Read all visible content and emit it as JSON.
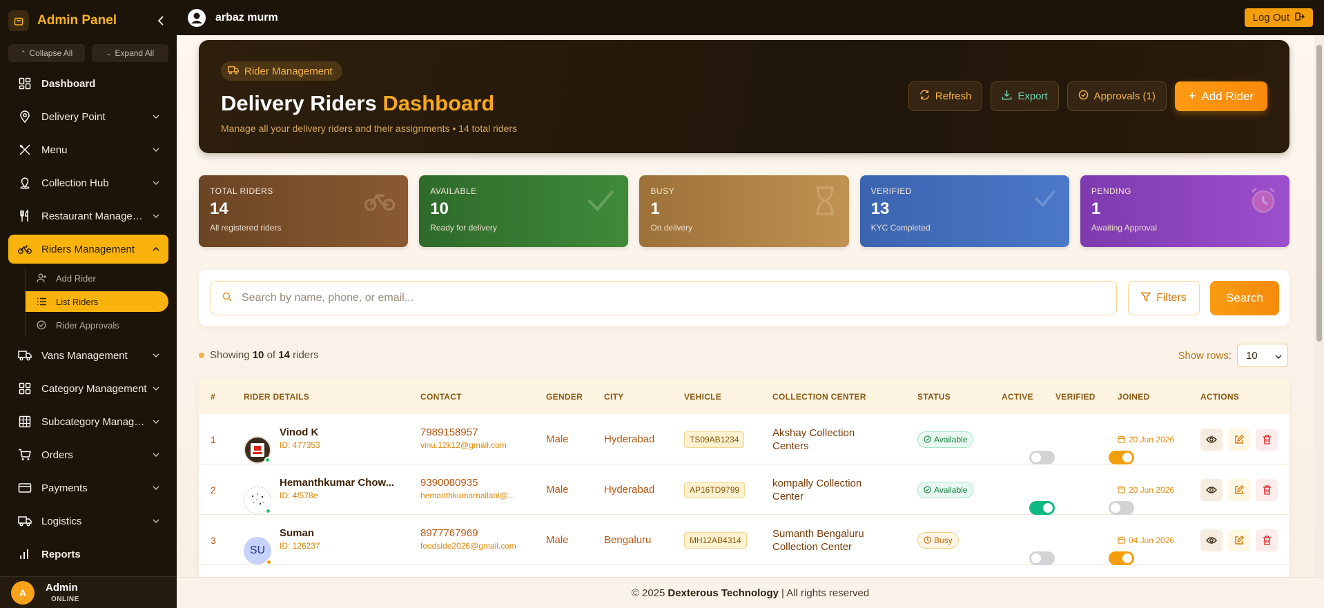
{
  "sidebar": {
    "title": "Admin Panel",
    "collapse_all": "Collapse All",
    "expand_all": "Expand All",
    "items": [
      {
        "label": "Dashboard",
        "icon": "dashboard-icon"
      },
      {
        "label": "Delivery Point",
        "icon": "map-pin-icon"
      },
      {
        "label": "Menu",
        "icon": "utensils-icon"
      },
      {
        "label": "Collection Hub",
        "icon": "location-icon"
      },
      {
        "label": "Restaurant Management",
        "icon": "fork-knife-icon"
      },
      {
        "label": "Riders Management",
        "icon": "bike-icon"
      },
      {
        "label": "Vans Management",
        "icon": "truck-icon"
      },
      {
        "label": "Category Management",
        "icon": "grid-icon"
      },
      {
        "label": "Subcategory Management",
        "icon": "table-icon"
      },
      {
        "label": "Orders",
        "icon": "cart-icon"
      },
      {
        "label": "Payments",
        "icon": "card-icon"
      },
      {
        "label": "Logistics",
        "icon": "truck-icon"
      },
      {
        "label": "Reports",
        "icon": "bar-chart-icon"
      }
    ],
    "sub_items": [
      {
        "label": "Add Rider"
      },
      {
        "label": "List Riders"
      },
      {
        "label": "Rider Approvals"
      }
    ],
    "user": {
      "name": "Admin",
      "status": "ONLINE",
      "initial": "A"
    }
  },
  "topbar": {
    "user_name": "arbaz murm",
    "logout": "Log Out"
  },
  "hero": {
    "badge": "Rider Management",
    "title_main": "Delivery Riders",
    "title_highlight": "Dashboard",
    "subtitle": "Manage all your delivery riders and their assignments • 14 total riders",
    "refresh": "Refresh",
    "export": "Export",
    "approvals": "Approvals (1)",
    "add_rider": "Add Rider"
  },
  "stats": [
    {
      "label": "TOTAL RIDERS",
      "value": "14",
      "desc": "All registered riders"
    },
    {
      "label": "AVAILABLE",
      "value": "10",
      "desc": "Ready for delivery"
    },
    {
      "label": "BUSY",
      "value": "1",
      "desc": "On delivery"
    },
    {
      "label": "VERIFIED",
      "value": "13",
      "desc": "KYC Completed"
    },
    {
      "label": "PENDING",
      "value": "1",
      "desc": "Awaiting Approval"
    }
  ],
  "search": {
    "placeholder": "Search by name, phone, or email...",
    "filters": "Filters",
    "button": "Search"
  },
  "listing": {
    "prefix": "Showing",
    "shown": "10",
    "of": "of",
    "total": "14",
    "suffix": "riders",
    "rows_label": "Show rows:",
    "rows_value": "10"
  },
  "table": {
    "headers": [
      "#",
      "RIDER DETAILS",
      "CONTACT",
      "GENDER",
      "CITY",
      "VEHICLE",
      "COLLECTION CENTER",
      "STATUS",
      "ACTIVE",
      "VERIFIED",
      "JOINED",
      "ACTIONS"
    ],
    "rows": [
      {
        "num": "1",
        "name": "Vinod K",
        "id": "ID: 477353",
        "phone": "7989158957",
        "email": "vinu.12k12@gmail.com",
        "gender": "Male",
        "city": "Hyderabad",
        "vehicle": "TS09AB1234",
        "center": "Akshay Collection Centers",
        "status": "Available",
        "active": false,
        "verified": true,
        "joined": "20 Jun 2026",
        "initials": ""
      },
      {
        "num": "2",
        "name": "Hemanthkumar Chow...",
        "id": "ID: 4f578e",
        "phone": "9390080935",
        "email": "hemanthkumarnallani@...",
        "gender": "Male",
        "city": "Hyderabad",
        "vehicle": "AP16TD9799",
        "center": "kompally Collection Center",
        "status": "Available",
        "active": true,
        "verified": false,
        "joined": "20 Jun 2026",
        "initials": ""
      },
      {
        "num": "3",
        "name": "Suman",
        "id": "ID: 126237",
        "phone": "8977767969",
        "email": "foodside2026@gmail.com",
        "gender": "Male",
        "city": "Bengaluru",
        "vehicle": "MH12AB4314",
        "center": "Sumanth Bengaluru Collection Center",
        "status": "Busy",
        "active": false,
        "verified": true,
        "joined": "04 Jun 2026",
        "initials": "SU"
      }
    ]
  },
  "footer": {
    "copyright": "© 2025",
    "company": "Dexterous Technology",
    "rights": "| All rights reserved"
  },
  "colors": {
    "accent": "#f9b30c",
    "primary_orange": "#f78a0a",
    "sidebar_bg": "#1c1409"
  }
}
